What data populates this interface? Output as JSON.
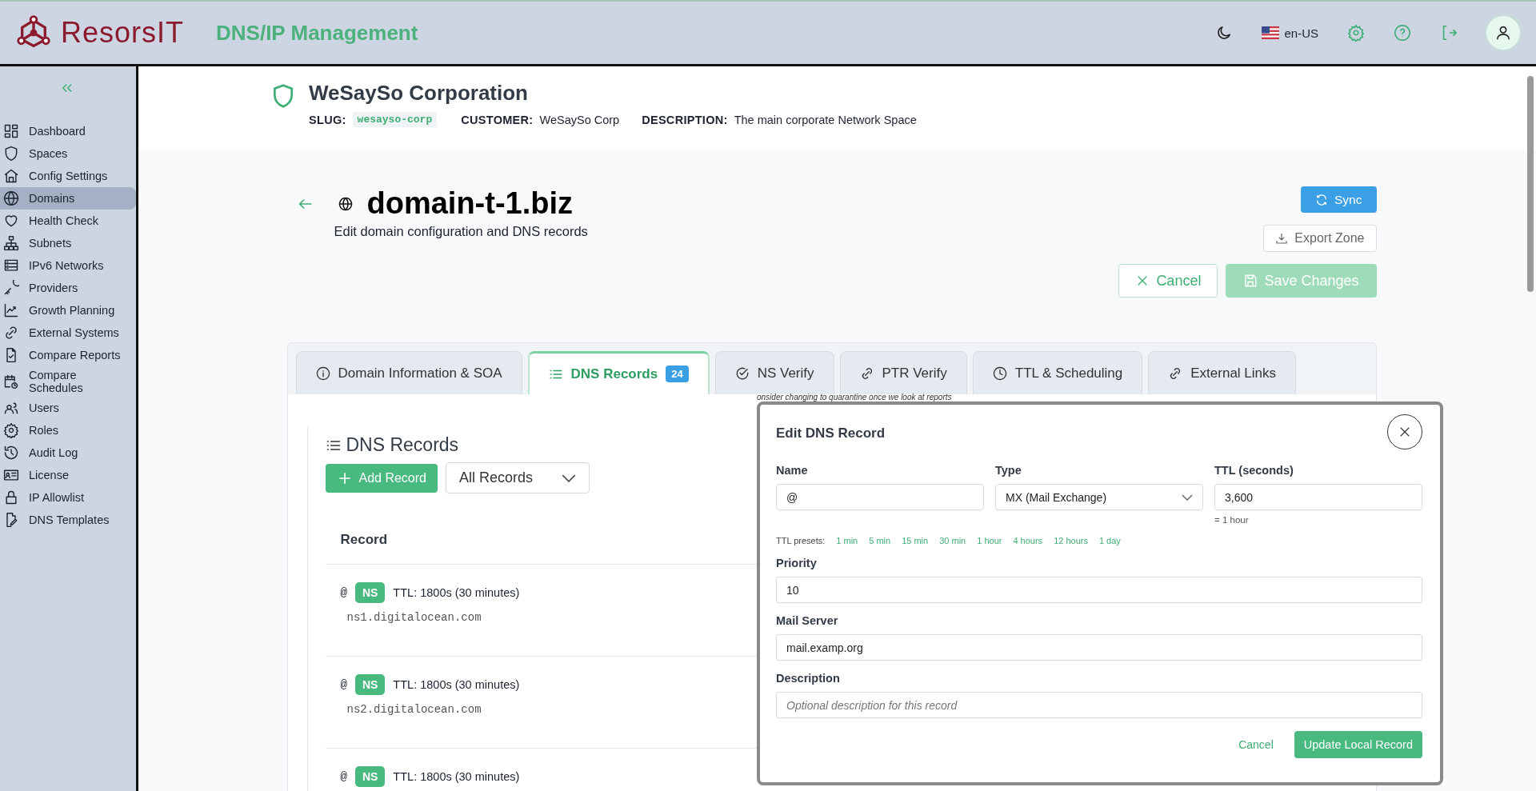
{
  "header": {
    "logo_text": "ResorsIT",
    "app_title": "DNS/IP Management",
    "language": "en-US"
  },
  "sidebar": {
    "items": [
      {
        "label": "Dashboard",
        "selected": false
      },
      {
        "label": "Spaces",
        "selected": false
      },
      {
        "label": "Config Settings",
        "selected": false
      },
      {
        "label": "Domains",
        "selected": true
      },
      {
        "label": "Health Check",
        "selected": false
      },
      {
        "label": "Subnets",
        "selected": false
      },
      {
        "label": "IPv6 Networks",
        "selected": false
      },
      {
        "label": "Providers",
        "selected": false
      },
      {
        "label": "Growth Planning",
        "selected": false
      },
      {
        "label": "External Systems",
        "selected": false
      },
      {
        "label": "Compare Reports",
        "selected": false
      },
      {
        "label": "Compare Schedules",
        "selected": false
      },
      {
        "label": "Users",
        "selected": false
      },
      {
        "label": "Roles",
        "selected": false
      },
      {
        "label": "Audit Log",
        "selected": false
      },
      {
        "label": "License",
        "selected": false
      },
      {
        "label": "IP Allowlist",
        "selected": false
      },
      {
        "label": "DNS Templates",
        "selected": false
      }
    ]
  },
  "organization": {
    "name": "WeSaySo Corporation",
    "meta": [
      {
        "label": "SLUG:",
        "value": "wesayso-corp",
        "kind": "code"
      },
      {
        "label": "CUSTOMER:",
        "value": "WeSaySo Corp",
        "kind": "text"
      },
      {
        "label": "DESCRIPTION:",
        "value": "The main corporate Network Space",
        "kind": "text"
      }
    ]
  },
  "domain": {
    "name": "domain-t-1.biz",
    "subtitle": "Edit domain configuration and DNS records"
  },
  "actions": {
    "sync": "Sync",
    "export_zone": "Export Zone",
    "cancel": "Cancel",
    "save": {
      "label": "Save Changes",
      "disabled": true
    }
  },
  "tabs": [
    {
      "label": "Domain Information & SOA",
      "selected": false
    },
    {
      "label": "DNS Records",
      "selected": true,
      "badge": "24"
    },
    {
      "label": "NS Verify",
      "selected": false
    },
    {
      "label": "PTR Verify",
      "selected": false
    },
    {
      "label": "TTL & Scheduling",
      "selected": false
    },
    {
      "label": "External Links",
      "selected": false
    }
  ],
  "records_panel": {
    "title": "DNS Records",
    "add_button": "Add Record",
    "filter": "All Records",
    "column": "Record",
    "rows": [
      {
        "name": "@",
        "type": "NS",
        "ttl": "TTL: 1800s (30 minutes)",
        "value": "ns1.digitalocean.com"
      },
      {
        "name": "@",
        "type": "NS",
        "ttl": "TTL: 1800s (30 minutes)",
        "value": "ns2.digitalocean.com"
      },
      {
        "name": "@",
        "type": "NS",
        "ttl": "TTL: 1800s (30 minutes)"
      }
    ]
  },
  "background_note": "onsider changing to quarantine once we look at reports",
  "modal": {
    "title": "Edit DNS Record",
    "name": {
      "label": "Name",
      "value": "@"
    },
    "type": {
      "label": "Type",
      "value": "MX (Mail Exchange)"
    },
    "ttl": {
      "label": "TTL (seconds)",
      "value": "3,600",
      "hint": "= 1 hour"
    },
    "presets_label": "TTL presets:",
    "presets": [
      "1 min",
      "5 min",
      "15 min",
      "30 min",
      "1 hour",
      "4 hours",
      "12 hours",
      "1 day"
    ],
    "priority": {
      "label": "Priority",
      "value": "10"
    },
    "mail_server": {
      "label": "Mail Server",
      "value": "mail.examp.org"
    },
    "description": {
      "label": "Description",
      "placeholder": "Optional description for this record"
    },
    "cancel": "Cancel",
    "submit": "Update Local Record"
  }
}
